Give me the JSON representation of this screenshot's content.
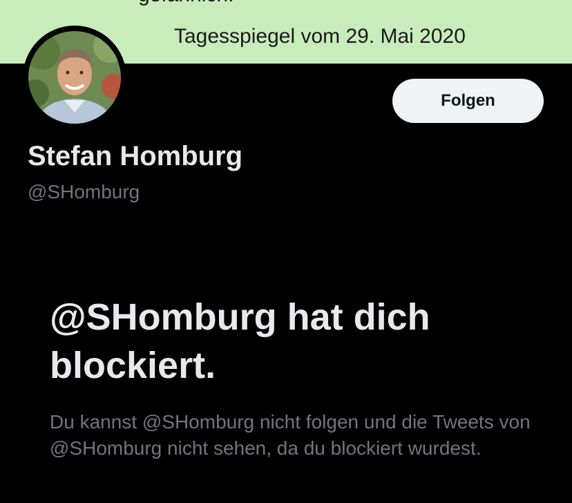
{
  "banner": {
    "cut_text": "gefährlich.",
    "caption": "Tagesspiegel vom 29. Mai 2020",
    "background_color": "#c8ecbc"
  },
  "profile": {
    "display_name": "Stefan Homburg",
    "handle": "@SHomburg",
    "follow_label": "Folgen"
  },
  "blocked": {
    "title": "@SHomburg hat dich blockiert.",
    "description": "Du kannst @SHomburg nicht folgen und die Tweets von @SHomburg nicht sehen, da du blockiert wurdest."
  },
  "colors": {
    "background": "#000000",
    "primary_text": "#e7e9ea",
    "secondary_text": "#71767b",
    "button_bg": "#eff3f4"
  }
}
